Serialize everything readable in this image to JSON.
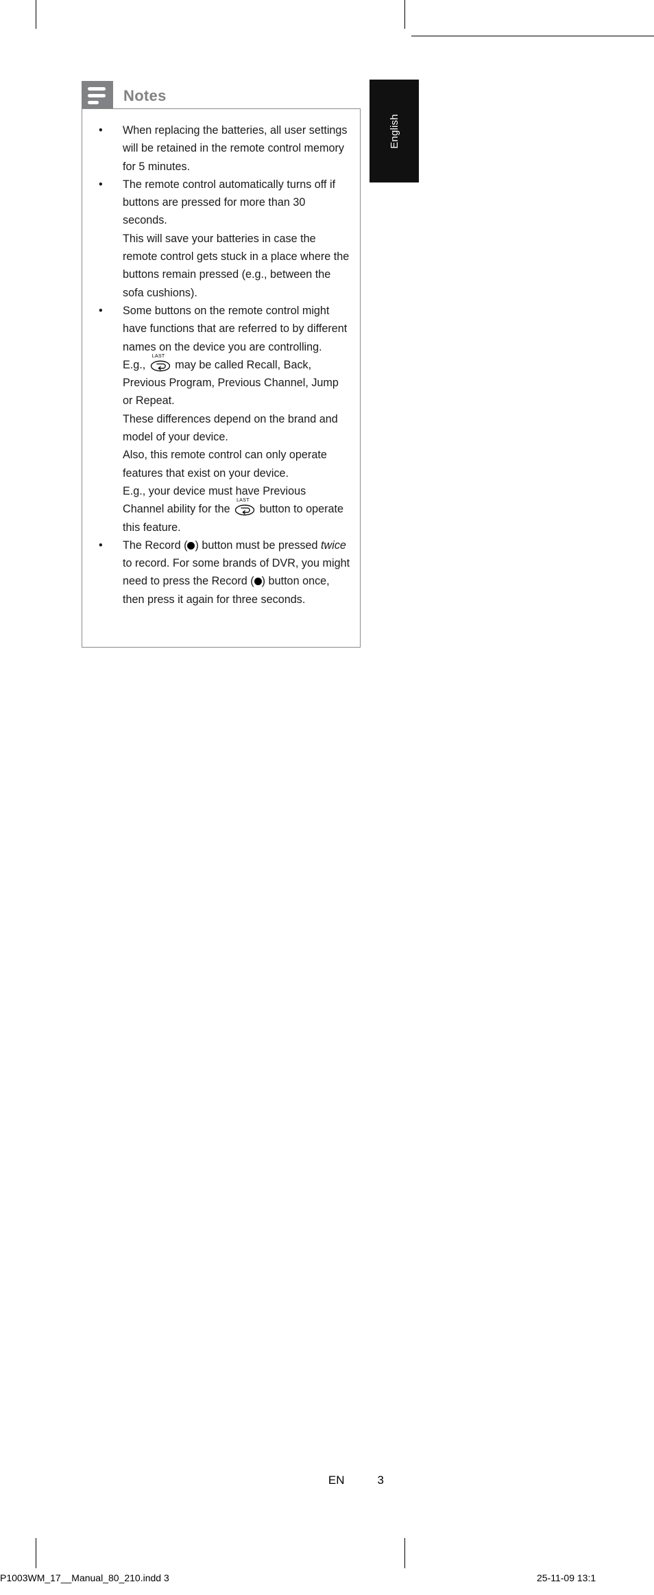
{
  "document": {
    "language_tab": "English",
    "page_label": "EN",
    "page_number": "3"
  },
  "notes_panel": {
    "icon_name": "notes-list-icon",
    "title": "Notes",
    "title_color": "#808285",
    "icon_bg_color": "#808285",
    "border_color": "#8a8a8a",
    "items": [
      {
        "paragraphs": [
          "When replacing the batteries, all user settings will be retained in the remote control memory for 5 minutes."
        ]
      },
      {
        "paragraphs": [
          "The remote control automatically turns off if buttons are pressed for more than 30 seconds.",
          "This will save your batteries in case the remote control gets stuck in a place where the buttons remain pressed (e.g., between the sofa cushions)."
        ]
      },
      {
        "paragraphs": [
          "Some buttons on the remote control might have functions that are referred to by different names on the device you are controlling."
        ],
        "eg_last_before": "E.g.,",
        "eg_last_after": "may be called Recall, Back, Previous Program, Previous Channel, Jump or Repeat.",
        "paragraphs_after": [
          "These differences depend on the brand and model of your device.",
          "Also, this remote control can only operate features that exist on your device."
        ],
        "eg2_before": "E.g., your device must have Previous Channel ability for the",
        "eg2_after": "button to operate this feature."
      },
      {
        "record_before": "The Record (",
        "record_mid": ") button must be pressed ",
        "record_italic": "twice",
        "record_after": " to record. For some brands of DVR, you might need to press the Record (",
        "record_tail": ") button once, then press it again for three seconds."
      }
    ],
    "last_button_caption": "LAST",
    "last_button_icon": "last-recall-button-icon",
    "record_button_icon": "record-dot-icon"
  },
  "print_footer": {
    "filename": "P1003WM_17__Manual_80_210.indd   3",
    "timestamp": "25-11-09   13:1"
  }
}
